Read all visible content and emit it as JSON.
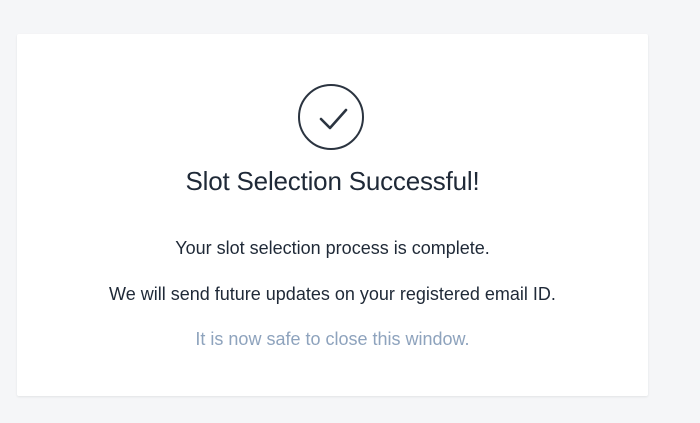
{
  "card": {
    "icon": "check-circle-icon",
    "title": "Slot Selection Successful!",
    "message_1": "Your slot selection process is complete.",
    "message_2": "We will send future updates on your registered email ID.",
    "message_3": "It is now safe to close this window."
  },
  "colors": {
    "background": "#f5f6f8",
    "card": "#ffffff",
    "text_primary": "#1f2937",
    "text_muted": "#8ea3bd",
    "icon_stroke": "#2b3440"
  }
}
